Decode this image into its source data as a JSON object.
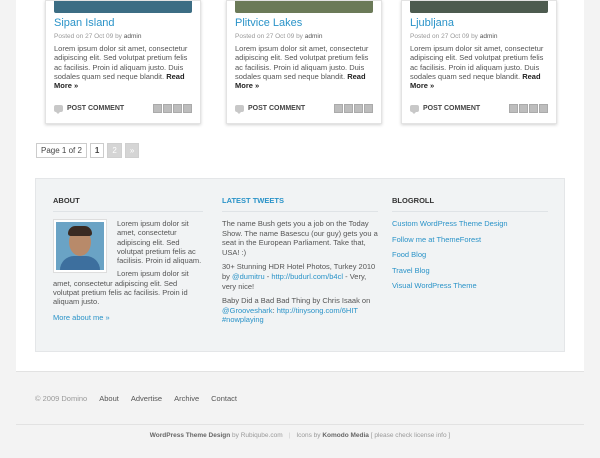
{
  "posts": [
    {
      "title": "Sipan Island",
      "meta_prefix": "Posted on 27 Oct 09 by",
      "author": "admin",
      "excerpt": "Lorem ipsum dolor sit amet, consectetur adipiscing elit. Sed volutpat pretium felis ac facilisis. Proin id aliquam justo. Duis sodales quam sed neque blandit.",
      "read_more": "Read More »",
      "comment_label": "POST COMMENT",
      "thumb_color": "#3c6d84"
    },
    {
      "title": "Plitvice Lakes",
      "meta_prefix": "Posted on 27 Oct 09 by",
      "author": "admin",
      "excerpt": "Lorem ipsum dolor sit amet, consectetur adipiscing elit. Sed volutpat pretium felis ac facilisis. Proin id aliquam justo. Duis sodales quam sed neque blandit.",
      "read_more": "Read More »",
      "comment_label": "POST COMMENT",
      "thumb_color": "#6b7a58"
    },
    {
      "title": "Ljubljana",
      "meta_prefix": "Posted on 27 Oct 09 by",
      "author": "admin",
      "excerpt": "Lorem ipsum dolor sit amet, consectetur adipiscing elit. Sed volutpat pretium felis ac facilisis. Proin id aliquam justo. Duis sodales quam sed neque blandit.",
      "read_more": "Read More »",
      "comment_label": "POST COMMENT",
      "thumb_color": "#4d5b4f"
    }
  ],
  "pagination": {
    "info": "Page 1 of 2",
    "current": "1",
    "page2": "2",
    "next": "»"
  },
  "widgets": {
    "about": {
      "title": "ABOUT",
      "text1": "Lorem ipsum dolor sit amet, consectetur adipiscing elit. Sed volutpat pretium felis ac facilisis. Proin id aliquam.",
      "text2": "Lorem ipsum dolor sit amet, consectetur adipiscing elit. Sed volutpat pretium felis ac facilisis. Proin id aliquam justo.",
      "more": "More about me »"
    },
    "tweets": {
      "title": "LATEST TWEETS",
      "items": [
        {
          "text": "The name Bush gets you a job on the Today Show. The name Basescu (our guy) gets you a seat in the European Parliament. Take that, USA! :)"
        },
        {
          "text_a": "30+ Stunning HDR Hotel Photos, Turkey 2010 by ",
          "mention": "@dumitru",
          "text_b": " - ",
          "link": "http://budurl.com/b4cl",
          "text_c": " - Very, very nice!"
        },
        {
          "text_a": "Baby Did a Bad Bad Thing by Chris Isaak on ",
          "mention": "@Grooveshark",
          "text_b": ": ",
          "link": "http://tinysong.com/6HIT",
          "text_c": " ",
          "hashtag": "#nowplaying"
        }
      ]
    },
    "blogroll": {
      "title": "BLOGROLL",
      "links": [
        "Custom WordPress Theme Design",
        "Follow me at ThemeForest",
        "Food Blog",
        "Travel Blog",
        "Visual WordPress Theme"
      ]
    }
  },
  "footer": {
    "copyright": "© 2009 Domino",
    "nav": [
      "About",
      "Advertise",
      "Archive",
      "Contact"
    ],
    "credit_design": "WordPress Theme Design",
    "credit_by": " by Rubiqube.com",
    "credit_icons": "Icons by ",
    "credit_komodo": "Komodo Media",
    "credit_license": " [ please check license info ]"
  },
  "colors": {
    "accent": "#2a93c8",
    "widget_bg": "#f1f3f4",
    "page_bg": "#f3f3f3"
  }
}
